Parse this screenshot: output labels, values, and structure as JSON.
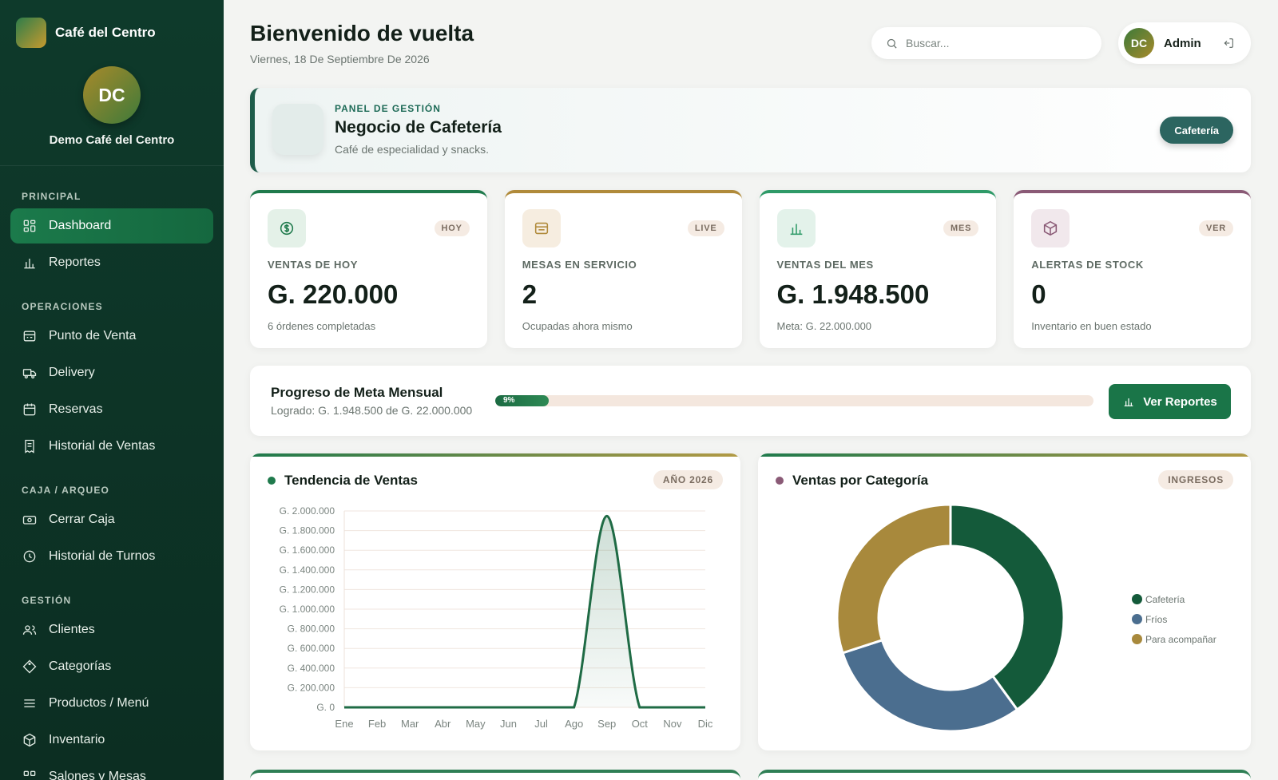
{
  "sidebar": {
    "brand_name": "Café del Centro",
    "org_initials": "DC",
    "org_name": "Demo Café del Centro",
    "sections": [
      {
        "label": "PRINCIPAL",
        "items": [
          {
            "label": "Dashboard",
            "icon": "grid-icon",
            "active": true
          },
          {
            "label": "Reportes",
            "icon": "bar-chart-icon"
          }
        ]
      },
      {
        "label": "OPERACIONES",
        "items": [
          {
            "label": "Punto de Venta",
            "icon": "register-icon"
          },
          {
            "label": "Delivery",
            "icon": "truck-icon"
          },
          {
            "label": "Reservas",
            "icon": "calendar-icon"
          },
          {
            "label": "Historial de Ventas",
            "icon": "receipt-icon"
          }
        ]
      },
      {
        "label": "CAJA / ARQUEO",
        "items": [
          {
            "label": "Cerrar Caja",
            "icon": "cash-icon"
          },
          {
            "label": "Historial de Turnos",
            "icon": "clock-icon"
          }
        ]
      },
      {
        "label": "GESTIÓN",
        "items": [
          {
            "label": "Clientes",
            "icon": "users-icon"
          },
          {
            "label": "Categorías",
            "icon": "tag-icon"
          },
          {
            "label": "Productos / Menú",
            "icon": "menu-icon"
          },
          {
            "label": "Inventario",
            "icon": "box-icon"
          },
          {
            "label": "Salones y Mesas",
            "icon": "tables-icon"
          }
        ]
      }
    ]
  },
  "header": {
    "title": "Bienvenido de vuelta",
    "date": "Viernes, 18 De Septiembre De 2026",
    "search_placeholder": "Buscar...",
    "user_initials": "DC",
    "user_name": "Admin"
  },
  "banner": {
    "eyebrow": "PANEL DE GESTIÓN",
    "title": "Negocio de Cafetería",
    "subtitle": "Café de especialidad y snacks.",
    "button": "Cafetería"
  },
  "kpis": [
    {
      "badge": "HOY",
      "label": "VENTAS DE HOY",
      "value": "G. 220.000",
      "sub": "6 órdenes completadas",
      "icon": "coin-icon",
      "color": "#1f7a4c",
      "icon_bg": "#e4f1e8"
    },
    {
      "badge": "LIVE",
      "label": "MESAS EN SERVICIO",
      "value": "2",
      "sub": "Ocupadas ahora mismo",
      "icon": "table-icon",
      "color": "#b08a3a",
      "icon_bg": "#f6ede0"
    },
    {
      "badge": "MES",
      "label": "VENTAS DEL MES",
      "value": "G. 1.948.500",
      "sub": "Meta: G. 22.000.000",
      "icon": "bar-chart-icon",
      "color": "#2f9a68",
      "icon_bg": "#e3f2ea"
    },
    {
      "badge": "VER",
      "label": "ALERTAS DE STOCK",
      "value": "0",
      "sub": "Inventario en buen estado",
      "icon": "box-icon",
      "color": "#8a5a76",
      "icon_bg": "#f1e8ec"
    }
  ],
  "progress": {
    "title": "Progreso de Meta Mensual",
    "subtitle": "Logrado: G. 1.948.500 de G. 22.000.000",
    "percent_label": "9%",
    "fraction": 0.09,
    "button": "Ver Reportes"
  },
  "charts": {
    "trend_title": "Tendencia de Ventas",
    "trend_badge": "AÑO 2026",
    "category_title": "Ventas por Categoría",
    "category_badge": "INGRESOS"
  },
  "chart_data": [
    {
      "type": "area",
      "title": "Tendencia de Ventas",
      "categories": [
        "Ene",
        "Feb",
        "Mar",
        "Abr",
        "May",
        "Jun",
        "Jul",
        "Ago",
        "Sep",
        "Oct",
        "Nov",
        "Dic"
      ],
      "values": [
        0,
        0,
        0,
        0,
        0,
        0,
        0,
        0,
        1948500,
        0,
        0,
        0
      ],
      "ylim": [
        0,
        2000000
      ],
      "yticks": [
        "G. 0",
        "G. 200.000",
        "G. 400.000",
        "G. 600.000",
        "G. 800.000",
        "G. 1.000.000",
        "G. 1.200.000",
        "G. 1.400.000",
        "G. 1.600.000",
        "G. 1.800.000",
        "G. 2.000.000"
      ],
      "grid": true,
      "line_color": "#1f6b45"
    },
    {
      "type": "pie",
      "title": "Ventas por Categoría",
      "categories": [
        "Cafetería",
        "Fríos",
        "Para acompañar"
      ],
      "values": [
        40,
        30,
        30
      ],
      "colors": [
        "#145a3a",
        "#4b6e8f",
        "#a8893c"
      ],
      "legend": "right"
    }
  ]
}
